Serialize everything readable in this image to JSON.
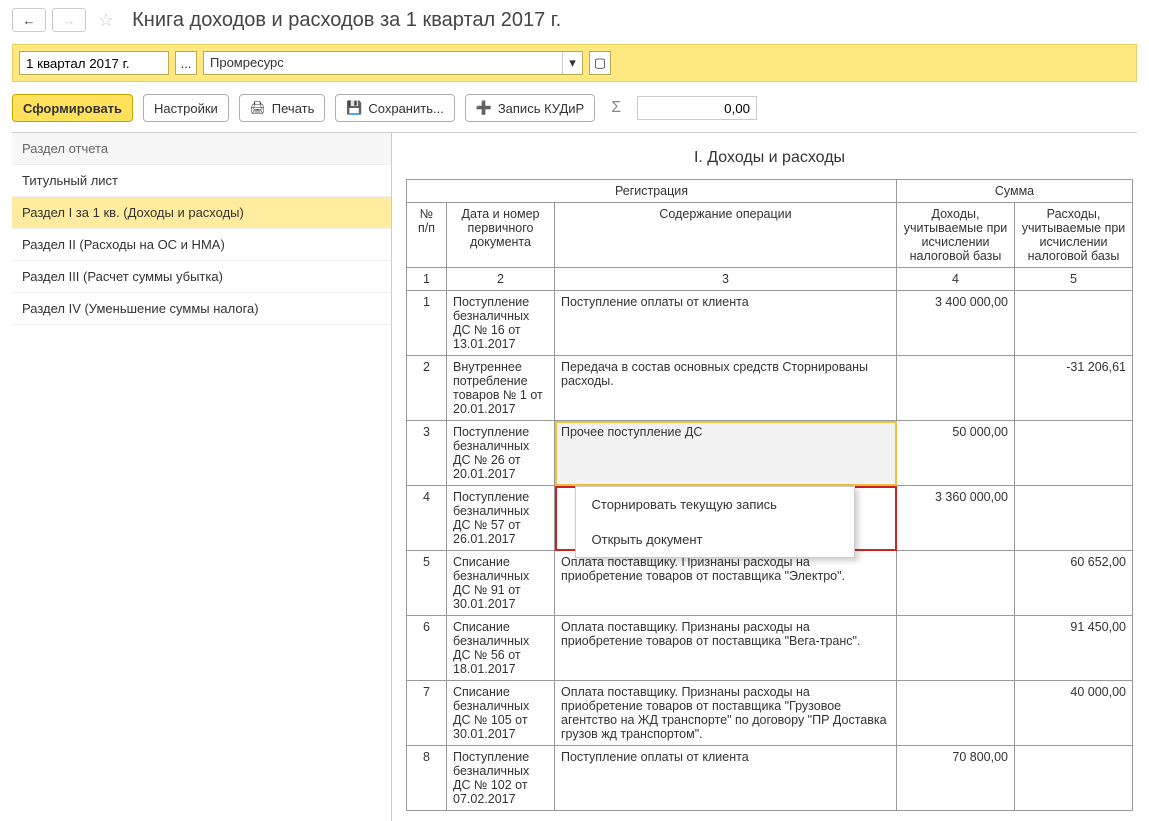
{
  "header": {
    "title": "Книга доходов и расходов за 1 квартал 2017 г."
  },
  "filters": {
    "period": "1 квартал 2017 г.",
    "organization": "Промресурс"
  },
  "toolbar": {
    "generate": "Сформировать",
    "settings": "Настройки",
    "print": "Печать",
    "save": "Сохранить...",
    "kudir": "Запись КУДиР",
    "sum": "0,00"
  },
  "sidebar": {
    "header": "Раздел отчета",
    "items": [
      "Титульный лист",
      "Раздел I за 1 кв. (Доходы и расходы)",
      "Раздел II (Расходы на ОС и НМА)",
      "Раздел III (Расчет суммы убытка)",
      "Раздел IV (Уменьшение суммы налога)"
    ],
    "activeIndex": 1
  },
  "section": {
    "title": "I. Доходы и расходы",
    "groupHeaders": {
      "reg": "Регистрация",
      "sum": "Сумма"
    },
    "columns": {
      "n": "№ п/п",
      "doc": "Дата и номер первичного документа",
      "op": "Содержание операции",
      "income": "Доходы, учитываемые при исчислении налоговой базы",
      "expense": "Расходы, учитываемые при исчислении налоговой базы"
    },
    "colnums": {
      "n": "1",
      "doc": "2",
      "op": "3",
      "income": "4",
      "expense": "5"
    },
    "rows": [
      {
        "n": "1",
        "doc": "Поступление безналичных ДС № 16 от 13.01.2017",
        "op": "Поступление оплаты от клиента",
        "income": "3 400 000,00",
        "expense": ""
      },
      {
        "n": "2",
        "doc": "Внутреннее потребление товаров № 1 от 20.01.2017",
        "op": "Передача в состав основных средств Сторнированы расходы.",
        "income": "",
        "expense": "-31 206,61"
      },
      {
        "n": "3",
        "doc": "Поступление безналичных ДС № 26 от 20.01.2017",
        "op": "Прочее поступление ДС",
        "income": "50 000,00",
        "expense": ""
      },
      {
        "n": "4",
        "doc": "Поступление безналичных ДС № 57 от 26.01.2017",
        "op": "",
        "income": "3 360 000,00",
        "expense": ""
      },
      {
        "n": "5",
        "doc": "Списание безналичных ДС № 91 от 30.01.2017",
        "op": "Оплата поставщику. Признаны расходы на приобретение товаров от поставщика \"Электро\".",
        "income": "",
        "expense": "60 652,00"
      },
      {
        "n": "6",
        "doc": "Списание безналичных ДС № 56 от 18.01.2017",
        "op": "Оплата поставщику. Признаны расходы на приобретение товаров от поставщика \"Вега-транс\".",
        "income": "",
        "expense": "91 450,00"
      },
      {
        "n": "7",
        "doc": "Списание безналичных ДС № 105 от 30.01.2017",
        "op": "Оплата поставщику. Признаны расходы на приобретение товаров от поставщика \"Грузовое агентство на ЖД транспорте\" по договору \"ПР Доставка грузов жд транспортом\".",
        "income": "",
        "expense": "40 000,00"
      },
      {
        "n": "8",
        "doc": "Поступление безналичных ДС № 102 от 07.02.2017",
        "op": "Поступление оплаты от клиента",
        "income": "70 800,00",
        "expense": ""
      }
    ]
  },
  "contextMenu": {
    "items": [
      "Сторнировать текущую запись",
      "Открыть документ"
    ]
  }
}
